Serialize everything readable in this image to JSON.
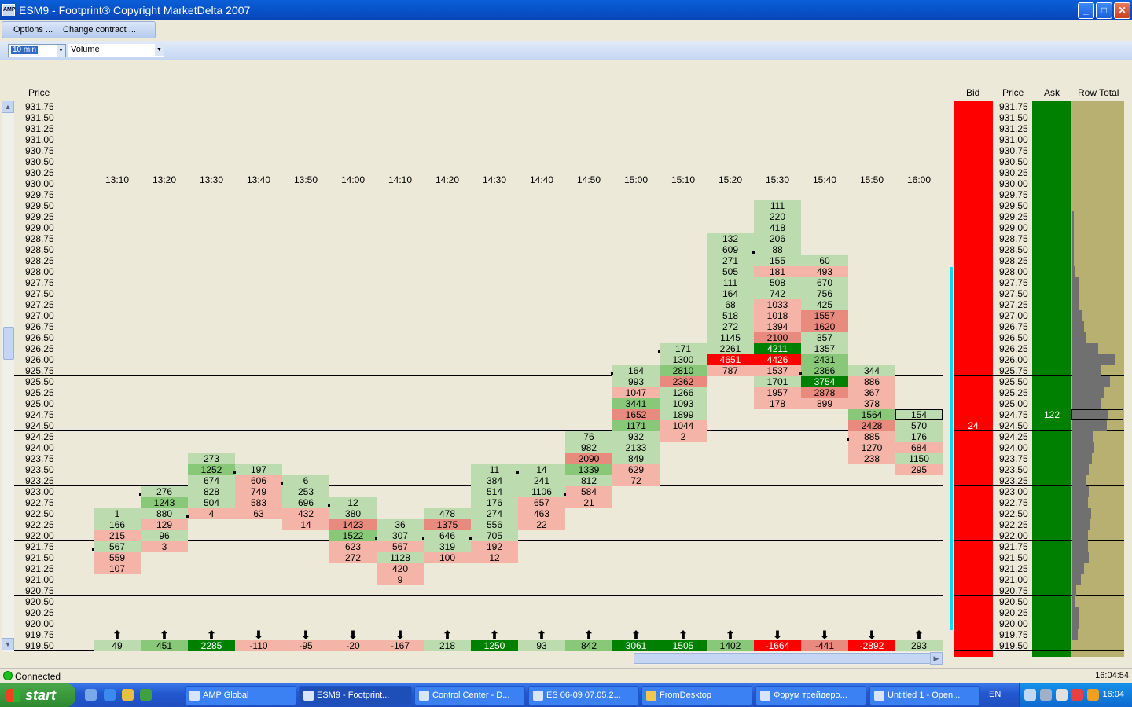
{
  "window": {
    "title": "ESM9 - Footprint® Copyright MarketDelta 2007",
    "minimize": "_",
    "maximize": "□",
    "close": "✕"
  },
  "menu": {
    "options": "Options ...",
    "change_contract": "Change contract ..."
  },
  "toolbar": {
    "interval": "10 min",
    "metric": "Volume"
  },
  "headers": {
    "price": "Price",
    "bid": "Bid",
    "price_right": "Price",
    "ask": "Ask",
    "row_total": "Row Total"
  },
  "times": [
    "13:10",
    "13:20",
    "13:30",
    "13:40",
    "13:50",
    "14:00",
    "14:10",
    "14:20",
    "14:30",
    "14:40",
    "14:50",
    "15:00",
    "15:10",
    "15:20",
    "15:30",
    "15:40",
    "15:50",
    "16:00"
  ],
  "prices": [
    "931.75",
    "931.50",
    "931.25",
    "931.00",
    "930.75",
    "930.50",
    "930.25",
    "930.00",
    "929.75",
    "929.50",
    "929.25",
    "929.00",
    "928.75",
    "928.50",
    "928.25",
    "928.00",
    "927.75",
    "927.50",
    "927.25",
    "927.00",
    "926.75",
    "926.50",
    "926.25",
    "926.00",
    "925.75",
    "925.50",
    "925.25",
    "925.00",
    "924.75",
    "924.50",
    "924.25",
    "924.00",
    "923.75",
    "923.50",
    "923.25",
    "923.00",
    "922.75",
    "922.50",
    "922.25",
    "922.00",
    "921.75",
    "921.50",
    "921.25",
    "921.00",
    "920.75",
    "920.50",
    "920.25",
    "920.00",
    "919.75",
    "919.50"
  ],
  "colors": {
    "lg": "#bcdcb0",
    "mg": "#88c878",
    "dg": "#008000",
    "lr": "#f4b4a8",
    "mr": "#e88a7e",
    "dr": "#ff0000",
    "bid": "#ff0000",
    "ask": "#008000",
    "rowtotal_bg": "#b8b070",
    "rowtotal_bar": "#707070",
    "cyan": "#00e0f0"
  },
  "columns": [
    {
      "cells": [
        [
          922.5,
          "1",
          "lg"
        ],
        [
          922.25,
          "166",
          "lg"
        ],
        [
          922.0,
          "215",
          "lr"
        ],
        [
          921.75,
          "567",
          "lg"
        ],
        [
          921.5,
          "559",
          "lr"
        ],
        [
          921.25,
          "107",
          "lr"
        ]
      ]
    },
    {
      "cells": [
        [
          923.0,
          "276",
          "lg"
        ],
        [
          922.75,
          "1243",
          "mg"
        ],
        [
          922.5,
          "880",
          "lg"
        ],
        [
          922.25,
          "129",
          "lr"
        ],
        [
          922.0,
          "96",
          "lg"
        ],
        [
          921.75,
          "3",
          "lr"
        ]
      ]
    },
    {
      "cells": [
        [
          923.75,
          "273",
          "lg"
        ],
        [
          923.5,
          "1252",
          "mg"
        ],
        [
          923.25,
          "674",
          "lg"
        ],
        [
          923.0,
          "828",
          "lg"
        ],
        [
          922.75,
          "504",
          "lg"
        ],
        [
          922.5,
          "4",
          "lr"
        ]
      ]
    },
    {
      "cells": [
        [
          923.5,
          "197",
          "lg"
        ],
        [
          923.25,
          "606",
          "lr"
        ],
        [
          923.0,
          "749",
          "lr"
        ],
        [
          922.75,
          "583",
          "lr"
        ],
        [
          922.5,
          "63",
          "lr"
        ]
      ]
    },
    {
      "cells": [
        [
          923.25,
          "6",
          "lg"
        ],
        [
          923.0,
          "253",
          "lg"
        ],
        [
          922.75,
          "696",
          "lg"
        ],
        [
          922.5,
          "432",
          "lr"
        ],
        [
          922.25,
          "14",
          "lr"
        ]
      ]
    },
    {
      "cells": [
        [
          922.75,
          "12",
          "lg"
        ],
        [
          922.5,
          "380",
          "lg"
        ],
        [
          922.25,
          "1423",
          "mr"
        ],
        [
          922.0,
          "1522",
          "mg"
        ],
        [
          921.75,
          "623",
          "lr"
        ],
        [
          921.5,
          "272",
          "lr"
        ]
      ]
    },
    {
      "cells": [
        [
          922.25,
          "36",
          "lg"
        ],
        [
          922.0,
          "307",
          "lg"
        ],
        [
          921.75,
          "567",
          "lr"
        ],
        [
          921.5,
          "1128",
          "lg"
        ],
        [
          921.25,
          "420",
          "lr"
        ],
        [
          921.0,
          "9",
          "lr"
        ]
      ]
    },
    {
      "cells": [
        [
          922.5,
          "478",
          "lg"
        ],
        [
          922.25,
          "1375",
          "mr"
        ],
        [
          922.0,
          "646",
          "lg"
        ],
        [
          921.75,
          "319",
          "lg"
        ],
        [
          921.5,
          "100",
          "lr"
        ]
      ]
    },
    {
      "cells": [
        [
          923.5,
          "11",
          "lg"
        ],
        [
          923.25,
          "384",
          "lg"
        ],
        [
          923.0,
          "514",
          "lg"
        ],
        [
          922.75,
          "176",
          "lg"
        ],
        [
          922.5,
          "274",
          "lg"
        ],
        [
          922.25,
          "556",
          "lg"
        ],
        [
          922.0,
          "705",
          "lg"
        ],
        [
          921.75,
          "192",
          "lr"
        ],
        [
          921.5,
          "12",
          "lr"
        ]
      ]
    },
    {
      "cells": [
        [
          923.5,
          "14",
          "lg"
        ],
        [
          923.25,
          "241",
          "lg"
        ],
        [
          923.0,
          "1106",
          "lg"
        ],
        [
          922.75,
          "657",
          "lr"
        ],
        [
          922.5,
          "463",
          "lr"
        ],
        [
          922.25,
          "22",
          "lr"
        ]
      ]
    },
    {
      "cells": [
        [
          924.25,
          "76",
          "lg"
        ],
        [
          924.0,
          "982",
          "lg"
        ],
        [
          923.75,
          "2090",
          "mr"
        ],
        [
          923.5,
          "1339",
          "mg"
        ],
        [
          923.25,
          "812",
          "lg"
        ],
        [
          923.0,
          "584",
          "lr"
        ],
        [
          922.75,
          "21",
          "lr"
        ]
      ]
    },
    {
      "cells": [
        [
          925.75,
          "164",
          "lg"
        ],
        [
          925.5,
          "993",
          "lg"
        ],
        [
          925.25,
          "1047",
          "lr"
        ],
        [
          925.0,
          "3441",
          "mg"
        ],
        [
          924.75,
          "1652",
          "mr"
        ],
        [
          924.5,
          "1171",
          "mg"
        ],
        [
          924.25,
          "932",
          "lg"
        ],
        [
          924.0,
          "2133",
          "lg"
        ],
        [
          923.75,
          "849",
          "lg"
        ],
        [
          923.5,
          "629",
          "lr"
        ],
        [
          923.25,
          "72",
          "lr"
        ]
      ]
    },
    {
      "cells": [
        [
          926.25,
          "171",
          "lg"
        ],
        [
          926.0,
          "1300",
          "lg"
        ],
        [
          925.75,
          "2810",
          "mg"
        ],
        [
          925.5,
          "2362",
          "mr"
        ],
        [
          925.25,
          "1266",
          "lg"
        ],
        [
          925.0,
          "1093",
          "lg"
        ],
        [
          924.75,
          "1899",
          "lg"
        ],
        [
          924.5,
          "1044",
          "lr"
        ],
        [
          924.25,
          "2",
          "lr"
        ]
      ]
    },
    {
      "cells": [
        [
          928.75,
          "132",
          "lg"
        ],
        [
          928.5,
          "609",
          "lg"
        ],
        [
          928.25,
          "271",
          "lg"
        ],
        [
          928.0,
          "505",
          "lg"
        ],
        [
          927.75,
          "111",
          "lg"
        ],
        [
          927.5,
          "164",
          "lg"
        ],
        [
          927.25,
          "68",
          "lg"
        ],
        [
          927.0,
          "518",
          "lg"
        ],
        [
          926.75,
          "272",
          "lg"
        ],
        [
          926.5,
          "1145",
          "lg"
        ],
        [
          926.25,
          "2261",
          "lg"
        ],
        [
          926.0,
          "4651",
          "dr"
        ],
        [
          925.75,
          "787",
          "lr"
        ]
      ]
    },
    {
      "cells": [
        [
          929.5,
          "111",
          "lg"
        ],
        [
          929.25,
          "220",
          "lg"
        ],
        [
          929.0,
          "418",
          "lg"
        ],
        [
          928.75,
          "206",
          "lg"
        ],
        [
          928.5,
          "88",
          "lg"
        ],
        [
          928.25,
          "155",
          "lg"
        ],
        [
          928.0,
          "181",
          "lr"
        ],
        [
          927.75,
          "508",
          "lg"
        ],
        [
          927.5,
          "742",
          "lg"
        ],
        [
          927.25,
          "1033",
          "lr"
        ],
        [
          927.0,
          "1018",
          "lr"
        ],
        [
          926.75,
          "1394",
          "lr"
        ],
        [
          926.5,
          "2100",
          "mr"
        ],
        [
          926.25,
          "4211",
          "dg"
        ],
        [
          926.0,
          "4426",
          "dr"
        ],
        [
          925.75,
          "1537",
          "lr"
        ],
        [
          925.5,
          "1701",
          "lg"
        ],
        [
          925.25,
          "1957",
          "lr"
        ],
        [
          925.0,
          "178",
          "lr"
        ]
      ]
    },
    {
      "cells": [
        [
          928.25,
          "60",
          "lg"
        ],
        [
          928.0,
          "493",
          "lr"
        ],
        [
          927.75,
          "670",
          "lg"
        ],
        [
          927.5,
          "756",
          "lg"
        ],
        [
          927.25,
          "425",
          "lg"
        ],
        [
          927.0,
          "1557",
          "mr"
        ],
        [
          926.75,
          "1620",
          "mr"
        ],
        [
          926.5,
          "857",
          "lg"
        ],
        [
          926.25,
          "1357",
          "lg"
        ],
        [
          926.0,
          "2431",
          "mg"
        ],
        [
          925.75,
          "2366",
          "mg"
        ],
        [
          925.5,
          "3754",
          "dg"
        ],
        [
          925.25,
          "2878",
          "mr"
        ],
        [
          925.0,
          "899",
          "lr"
        ]
      ]
    },
    {
      "cells": [
        [
          925.75,
          "344",
          "lg"
        ],
        [
          925.5,
          "886",
          "lr"
        ],
        [
          925.25,
          "367",
          "lr"
        ],
        [
          925.0,
          "378",
          "lr"
        ],
        [
          924.75,
          "1564",
          "mg"
        ],
        [
          924.5,
          "2428",
          "mr"
        ],
        [
          924.25,
          "885",
          "lr"
        ],
        [
          924.0,
          "1270",
          "lr"
        ],
        [
          923.75,
          "238",
          "lr"
        ]
      ]
    },
    {
      "cells": [
        [
          924.75,
          "154",
          "lg"
        ],
        [
          924.5,
          "570",
          "lg"
        ],
        [
          924.25,
          "176",
          "lg"
        ],
        [
          924.0,
          "684",
          "lr"
        ],
        [
          923.75,
          "1150",
          "lg"
        ],
        [
          923.5,
          "295",
          "lr"
        ]
      ]
    }
  ],
  "totals": [
    [
      "49",
      "lg",
      "up"
    ],
    [
      "451",
      "mg",
      "up"
    ],
    [
      "2285",
      "dg",
      "up"
    ],
    [
      "-110",
      "lr",
      "down"
    ],
    [
      "-95",
      "lr",
      "down"
    ],
    [
      "-20",
      "lr",
      "down"
    ],
    [
      "-167",
      "lr",
      "down"
    ],
    [
      "218",
      "lg",
      "up"
    ],
    [
      "1250",
      "dg",
      "up"
    ],
    [
      "93",
      "lg",
      "up"
    ],
    [
      "842",
      "mg",
      "up"
    ],
    [
      "3061",
      "dg",
      "up"
    ],
    [
      "1505",
      "dg",
      "up"
    ],
    [
      "1402",
      "mg",
      "up"
    ],
    [
      "-1664",
      "dr",
      "down"
    ],
    [
      "-441",
      "mr",
      "down"
    ],
    [
      "-2892",
      "dr",
      "down"
    ],
    [
      "293",
      "lg",
      "up"
    ]
  ],
  "bid_value": "24",
  "ask_value": "122",
  "rowtotal_levels": [
    0,
    0,
    0,
    0,
    0,
    0,
    0,
    0,
    0,
    0,
    0.03,
    0.03,
    0.03,
    0.03,
    0.03,
    0.05,
    0.12,
    0.12,
    0.14,
    0.18,
    0.22,
    0.26,
    0.5,
    0.84,
    0.56,
    0.72,
    0.62,
    0.54,
    0.7,
    0.66,
    0.4,
    0.42,
    0.38,
    0.32,
    0.28,
    0.32,
    0.3,
    0.36,
    0.34,
    0.3,
    0.3,
    0.32,
    0.22,
    0.16,
    0.08,
    0.06,
    0.12,
    0.14,
    0.1,
    0
  ],
  "status": {
    "connection": "Connected",
    "time": "16:04:54"
  },
  "taskbar": {
    "start": "start",
    "tasks": [
      "AMP Global",
      "ESM9 - Footprint...",
      "Control Center - D...",
      "ES 06-09  07.05.2...",
      "FromDesktop",
      "Форум трейдеро...",
      "Untitled 1 - Open..."
    ],
    "lang": "EN",
    "clock": "16:04"
  }
}
